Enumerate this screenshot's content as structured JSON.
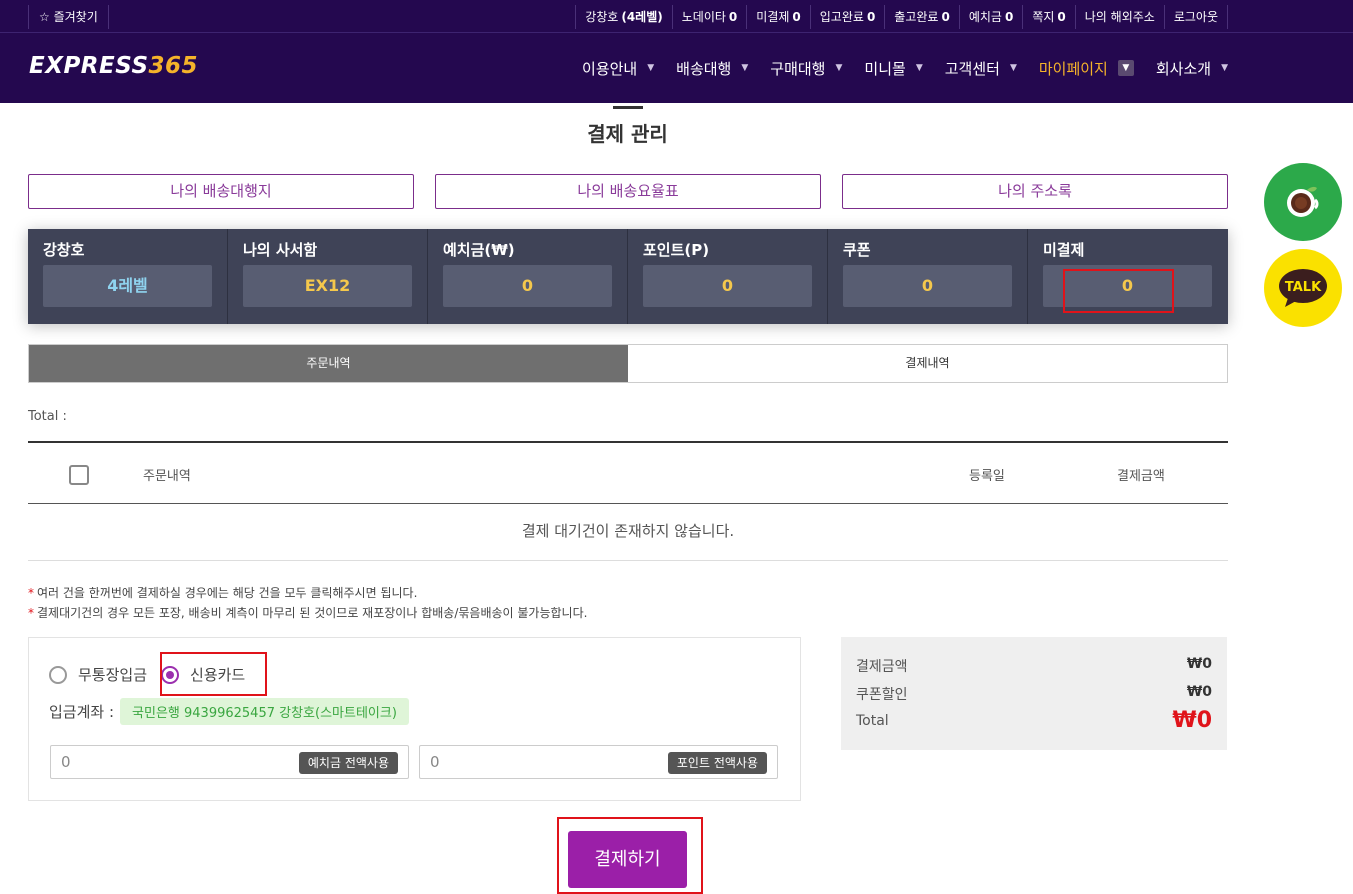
{
  "topbar": {
    "favorites": "☆ 즐겨찾기",
    "items": [
      {
        "label": "강창호",
        "value": "(4레벨)"
      },
      {
        "label": "노데이타",
        "value": "0"
      },
      {
        "label": "미결제",
        "value": "0"
      },
      {
        "label": "입고완료",
        "value": "0"
      },
      {
        "label": "출고완료",
        "value": "0"
      },
      {
        "label": "예치금",
        "value": "0"
      },
      {
        "label": "쪽지",
        "value": "0"
      },
      {
        "label": "나의 해외주소",
        "value": ""
      },
      {
        "label": "로그아웃",
        "value": ""
      }
    ]
  },
  "nav": {
    "logo_a": "EXPRESS",
    "logo_b": "365",
    "menu": [
      "이용안내",
      "배송대행",
      "구매대행",
      "미니몰",
      "고객센터",
      "마이페이지",
      "회사소개"
    ],
    "caret": "▼"
  },
  "page": {
    "title": "결제 관리",
    "links": [
      "나의 배송대행지",
      "나의 배송요율표",
      "나의 주소록"
    ]
  },
  "summary": [
    {
      "label": "강창호",
      "value": "4레벨"
    },
    {
      "label": "나의 사서함",
      "value": "EX12"
    },
    {
      "label": "예치금(₩)",
      "value": "0"
    },
    {
      "label": "포인트(P)",
      "value": "0"
    },
    {
      "label": "쿠폰",
      "value": "0"
    },
    {
      "label": "미결제",
      "value": "0"
    }
  ],
  "tabs": [
    "주문내역",
    "결제내역"
  ],
  "table": {
    "total_label": "Total :",
    "headers": [
      "주문내역",
      "등록일",
      "결제금액"
    ],
    "empty": "결제 대기건이 존재하지 않습니다."
  },
  "notes": [
    "여러 건을 한꺼번에 결제하실 경우에는 해당 건을 모두 클릭해주시면 됩니다.",
    "결제대기건의 경우 모든 포장, 배송비 계측이 마무리 된 것이므로 재포장이나 합배송/묶음배송이 불가능합니다."
  ],
  "note_mark": "*",
  "payment": {
    "methods": [
      "무통장입금",
      "신용카드"
    ],
    "selected": "신용카드",
    "account_label": "입금계좌 :",
    "account_value": "국민은행  94399625457 강창호(스마트테이크)",
    "deposit_value": "0",
    "deposit_btn": "예치금 전액사용",
    "point_value": "0",
    "point_btn": "포인트 전액사용"
  },
  "totals": {
    "amount_label": "결제금액",
    "amount": "₩0",
    "coupon_label": "쿠폰할인",
    "coupon": "₩0",
    "total_label": "Total",
    "total": "₩0"
  },
  "pay_button": "결제하기",
  "floating": {
    "talk": "TALK"
  },
  "colors": {
    "nav_bg": "#24084f",
    "accent": "#f5b32a",
    "purple": "#9b1fa8",
    "highlight": "#e0131a"
  }
}
